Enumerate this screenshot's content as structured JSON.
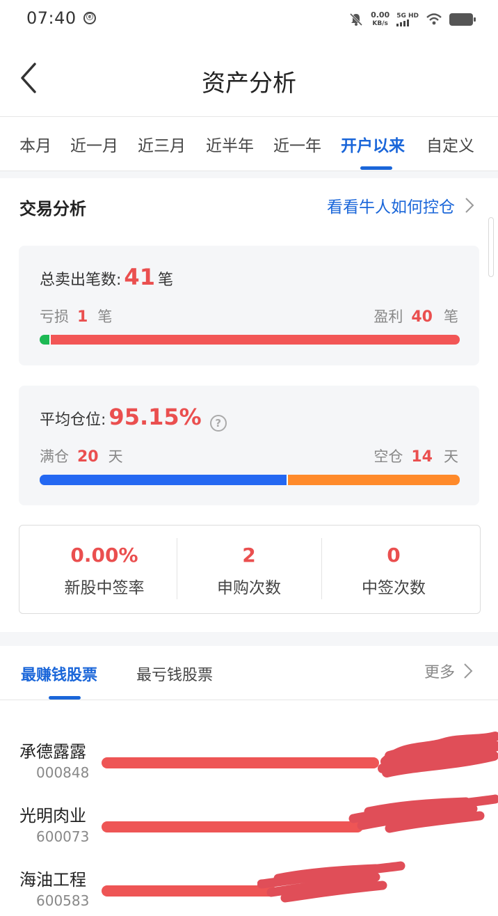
{
  "colors": {
    "accent_blue": "#1a66d9",
    "profit_red": "#ea4f4f",
    "loss_green": "#1db954",
    "full_position_blue": "#2468f2",
    "empty_position_orange": "#ff8a2b",
    "card_bg": "#f5f6f8"
  },
  "status_bar": {
    "time": "07:40",
    "net_speed_value": "0.00",
    "net_speed_unit": "KB/s",
    "network": "5G HD",
    "icons": [
      "app-notification-icon",
      "mute-bell-icon",
      "signal-icon",
      "wifi-icon",
      "battery-icon"
    ]
  },
  "header": {
    "title": "资产分析",
    "back_icon": "chevron-left-icon"
  },
  "period_tabs": [
    {
      "label": "本月",
      "active": false
    },
    {
      "label": "近一月",
      "active": false
    },
    {
      "label": "近三月",
      "active": false
    },
    {
      "label": "近半年",
      "active": false
    },
    {
      "label": "近一年",
      "active": false
    },
    {
      "label": "开户以来",
      "active": true
    },
    {
      "label": "自定义",
      "active": false
    }
  ],
  "trade_analysis": {
    "title": "交易分析",
    "link_label": "看看牛人如何控仓",
    "sell_card": {
      "label": "总卖出笔数:",
      "total": "41",
      "unit": "笔",
      "loss_label": "亏损",
      "loss_count": "1",
      "profit_label": "盈利",
      "profit_count": "40",
      "loss_fraction": 0.024
    },
    "position_card": {
      "label": "平均仓位:",
      "value": "95.15%",
      "full_label": "满仓",
      "full_days": "20",
      "empty_label": "空仓",
      "empty_days": "14",
      "day_unit": "天",
      "full_fraction": 0.588
    },
    "ipo_stats": [
      {
        "value": "0.00%",
        "label": "新股中签率"
      },
      {
        "value": "2",
        "label": "申购次数"
      },
      {
        "value": "0",
        "label": "中签次数"
      }
    ]
  },
  "stock_ranking": {
    "tabs": [
      {
        "label": "最赚钱股票",
        "active": true
      },
      {
        "label": "最亏钱股票",
        "active": false
      }
    ],
    "more_label": "更多",
    "stocks": [
      {
        "name": "承德露露",
        "code": "000848",
        "bar_fraction": 0.7
      },
      {
        "name": "光明肉业",
        "code": "600073",
        "bar_fraction": 0.66
      },
      {
        "name": "海油工程",
        "code": "600583",
        "bar_fraction": 0.44
      }
    ]
  }
}
